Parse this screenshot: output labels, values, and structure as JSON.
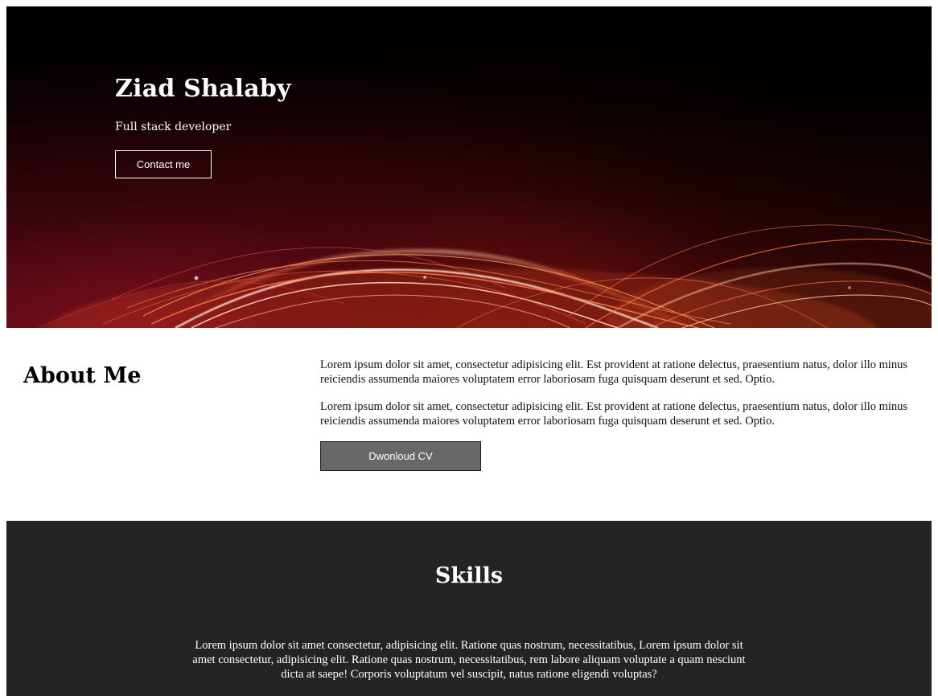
{
  "hero": {
    "name": "Ziad Shalaby",
    "role": "Full stack developer",
    "contact_label": "Contact me",
    "background_colors": [
      "#000000",
      "#3a0708",
      "#ff6a2a"
    ]
  },
  "about": {
    "heading": "About Me",
    "paragraphs": [
      "Lorem ipsum dolor sit amet, consectetur adipisicing elit. Est provident at ratione delectus, praesentium natus, dolor illo minus reiciendis assumenda maiores voluptatem error laboriosam fuga quisquam deserunt et sed. Optio.",
      "Lorem ipsum dolor sit amet, consectetur adipisicing elit. Est provident at ratione delectus, praesentium natus, dolor illo minus reiciendis assumenda maiores voluptatem error laboriosam fuga quisquam deserunt et sed. Optio."
    ],
    "download_label": "Dwonloud CV",
    "button_color": "#686868"
  },
  "skills": {
    "heading": "Skills",
    "paragraph": "Lorem ipsum dolor sit amet consectetur, adipisicing elit. Ratione quas nostrum, necessitatibus, Lorem ipsum dolor sit amet consectetur, adipisicing elit. Ratione quas nostrum, necessitatibus, rem labore aliquam voluptate a quam nesciunt dicta at saepe! Corporis voluptatum vel suscipit, natus ratione eligendi voluptas?",
    "background_color": "#242424"
  }
}
